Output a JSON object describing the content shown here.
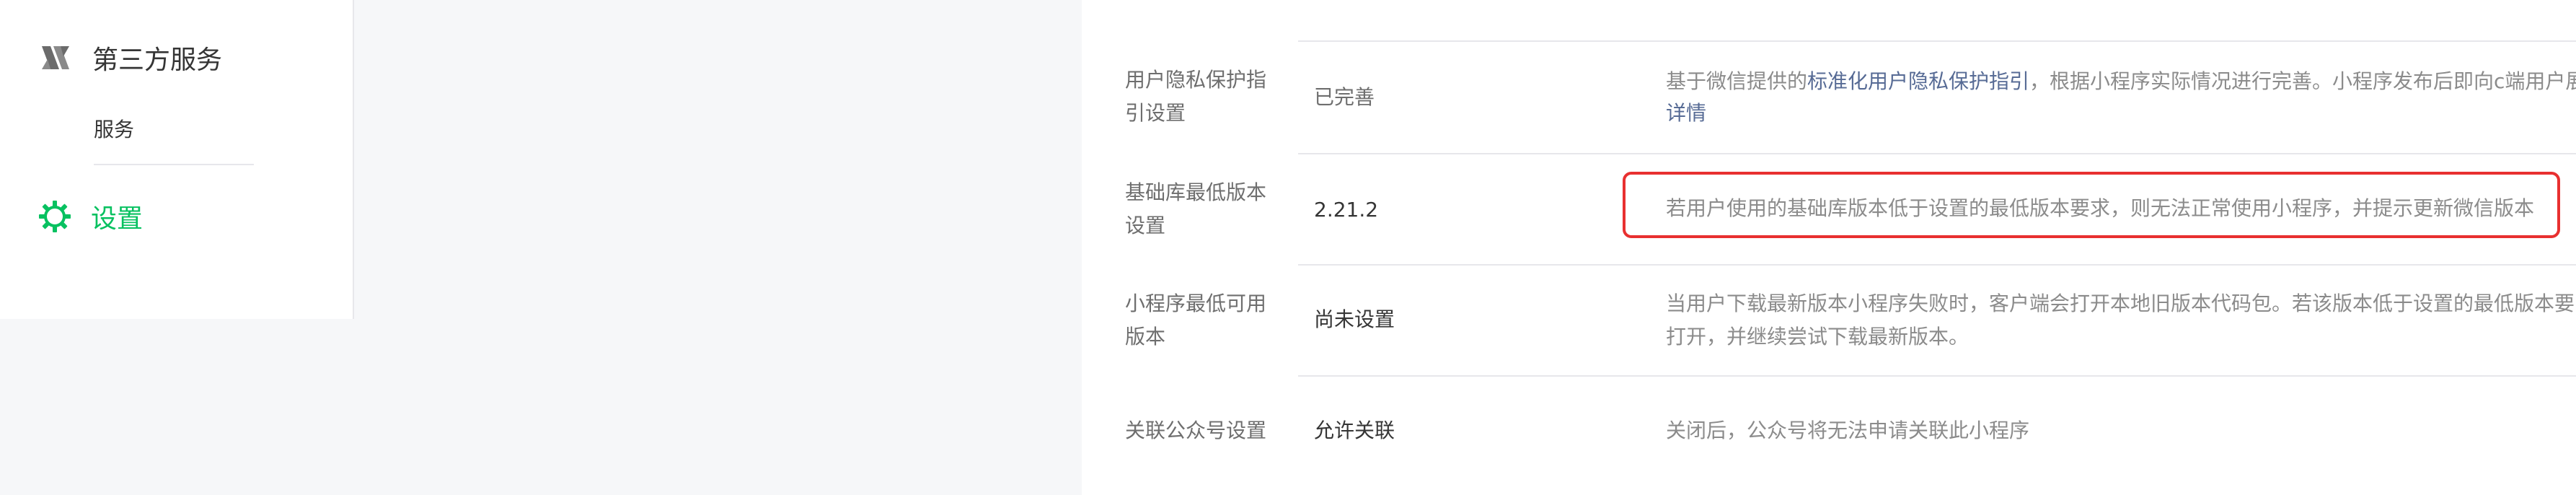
{
  "sidebar": {
    "third_party": {
      "title": "第三方服务",
      "icon": "third-party-logo-icon",
      "items": [
        {
          "label": "服务"
        }
      ]
    },
    "settings": {
      "title": "设置",
      "icon": "gear-icon",
      "color": "#07c160"
    }
  },
  "settings_rows": [
    {
      "label": "用户隐私保护指引设置",
      "value": "已完善",
      "desc_prefix": "基于微信提供的",
      "desc_link": "标准化用户隐私保护指引",
      "desc_suffix": "，根据小程序实际情况进行完善。小程序发布后即向c端用户展",
      "desc_line2_link": "详情"
    },
    {
      "label": "基础库最低版本设置",
      "value": "2.21.2",
      "desc": "若用户使用的基础库版本低于设置的最低版本要求，则无法正常使用小程序，并提示更新微信版本"
    },
    {
      "label": "小程序最低可用版本",
      "value": "尚未设置",
      "desc_line1": "当用户下载最新版本小程序失败时，客户端会打开本地旧版本代码包。若该版本低于设置的最低版本要",
      "desc_line2": "打开，并继续尝试下载最新版本。"
    },
    {
      "label": "关联公众号设置",
      "value": "允许关联",
      "desc": "关闭后，公众号将无法申请关联此小程序"
    }
  ],
  "colors": {
    "accent_green": "#07c160",
    "link_blue": "#576b95",
    "highlight_red": "#e83030"
  }
}
